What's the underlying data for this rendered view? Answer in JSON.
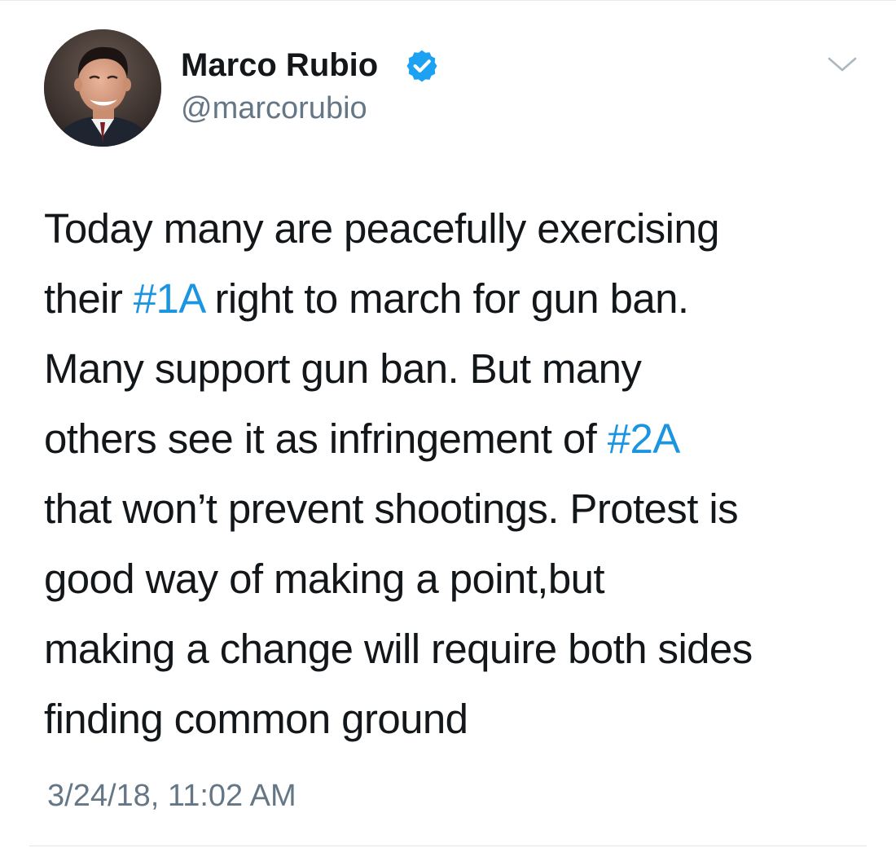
{
  "tweet": {
    "author": {
      "display_name": "Marco Rubio",
      "handle": "@marcorubio",
      "verified": true,
      "avatar_icon": "profile-photo"
    },
    "menu_icon": "chevron-down-icon",
    "text_lines": [
      [
        {
          "text": "Today many are peacefully exercising",
          "type": "text"
        }
      ],
      [
        {
          "text": "their ",
          "type": "text"
        },
        {
          "text": "#1A",
          "type": "hashtag"
        },
        {
          "text": " right to march for gun ban.",
          "type": "text"
        }
      ],
      [
        {
          "text": "Many support gun ban. But many",
          "type": "text"
        }
      ],
      [
        {
          "text": "others see it as infringement of ",
          "type": "text"
        },
        {
          "text": "#2A",
          "type": "hashtag"
        }
      ],
      [
        {
          "text": "that won’t prevent shootings. Protest is",
          "type": "text"
        }
      ],
      [
        {
          "text": "good way of making a point,but",
          "type": "text"
        }
      ],
      [
        {
          "text": "making a change will require both sides",
          "type": "text"
        }
      ],
      [
        {
          "text": "finding common ground",
          "type": "text"
        }
      ]
    ],
    "timestamp": "3/24/18, 11:02 AM"
  },
  "colors": {
    "text": "#14171a",
    "secondary": "#657786",
    "link": "#1b95e0",
    "verified_badge": "#1da1f2",
    "divider": "#e1e8ed"
  }
}
